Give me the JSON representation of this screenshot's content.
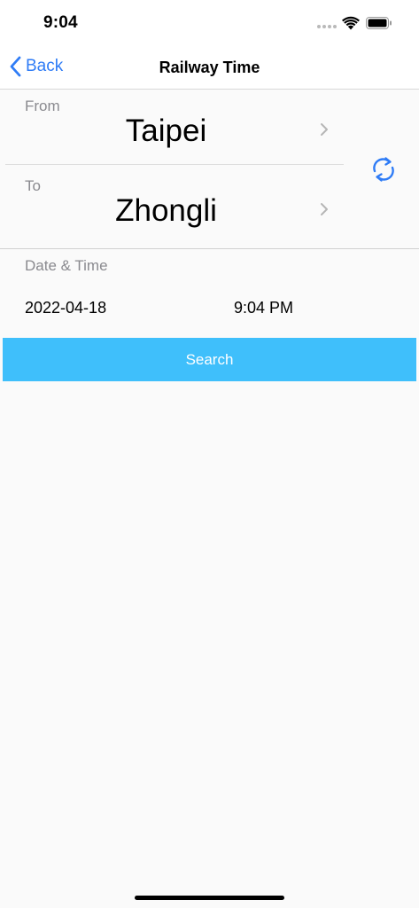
{
  "status_bar": {
    "time": "9:04"
  },
  "nav": {
    "back_label": "Back",
    "title": "Railway Time"
  },
  "route": {
    "from_label": "From",
    "from_station": "Taipei",
    "to_label": "To",
    "to_station": "Zhongli"
  },
  "datetime": {
    "label": "Date & Time",
    "date": "2022-04-18",
    "time": "9:04 PM"
  },
  "search_button_label": "Search",
  "colors": {
    "accent": "#2f7cf6",
    "search_button": "#3fbffb",
    "secondary_text": "#8a8a8f",
    "background": "#fafafa"
  }
}
